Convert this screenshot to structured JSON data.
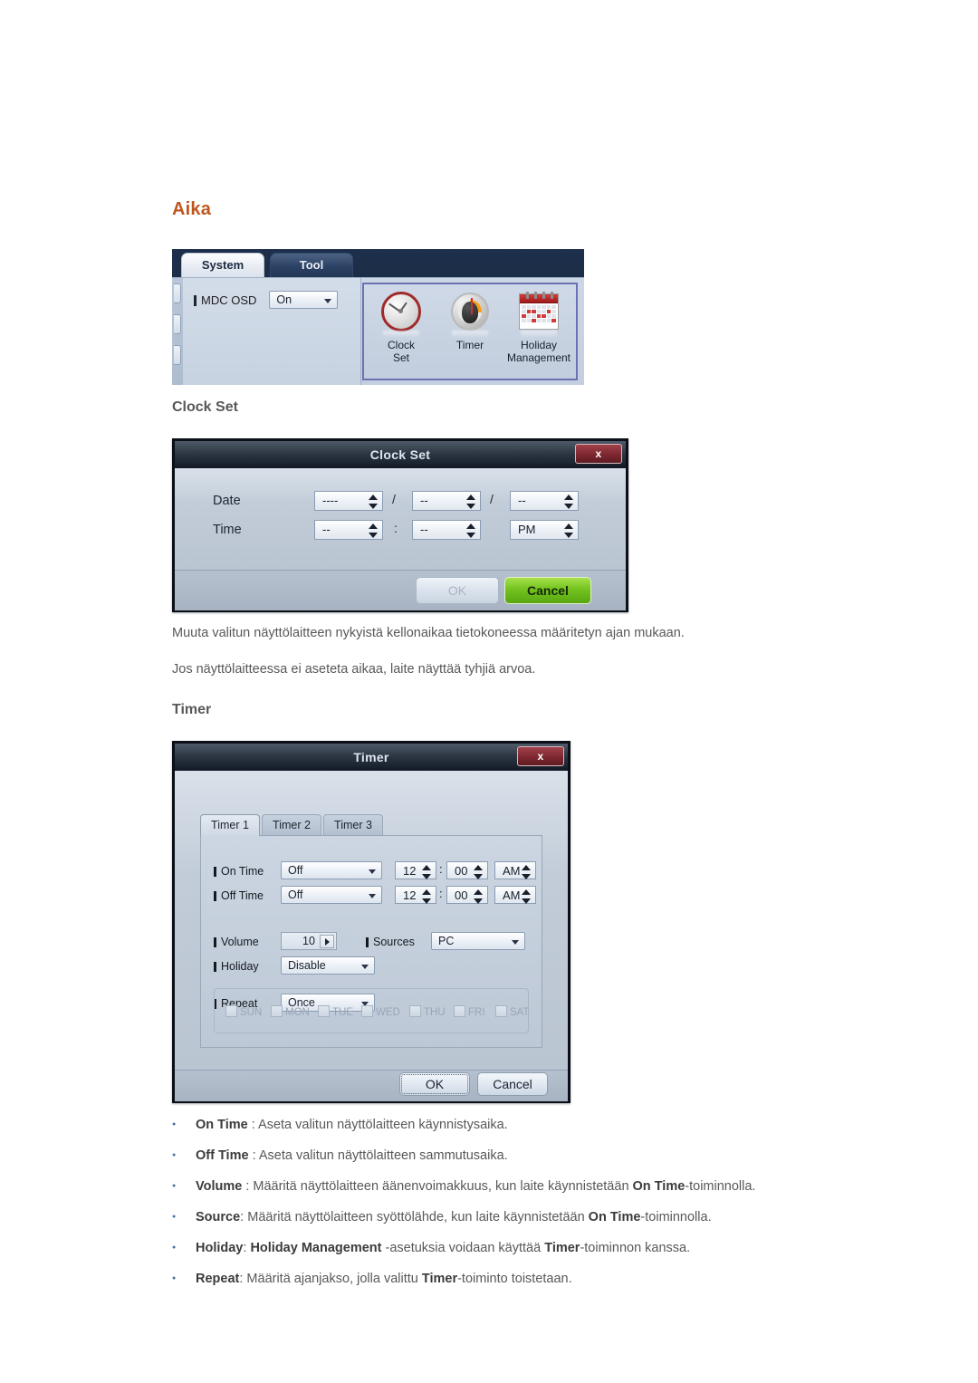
{
  "page": {
    "section_heading": "Aika",
    "accent_color": "#c0561f",
    "body_text_color": "#58585a",
    "bullet_color": "#4472a8"
  },
  "mdc_panel": {
    "tabs": [
      {
        "label": "System",
        "active": true
      },
      {
        "label": "Tool",
        "active": false
      }
    ],
    "settings": {
      "mdc_osd_label": "MDC OSD",
      "mdc_osd_value": "On"
    },
    "icon_group": {
      "highlight_color": "#6f6fb6",
      "items": [
        {
          "icon": "alarm-clock-icon",
          "line1": "Clock",
          "line2": "Set"
        },
        {
          "icon": "stopwatch-timer-icon",
          "line1": "Timer",
          "line2": ""
        },
        {
          "icon": "calendar-icon",
          "line1": "Holiday",
          "line2": "Management"
        }
      ]
    }
  },
  "clock_set": {
    "subheading": "Clock Set",
    "dialog": {
      "title": "Clock Set",
      "close_label": "x",
      "date_label": "Date",
      "time_label": "Time",
      "date_separator": "/",
      "time_separator": ":",
      "date_year": "----",
      "date_month": "--",
      "date_day": "--",
      "time_hour": "--",
      "time_minute": "--",
      "time_meridiem": "PM",
      "ok_label": "OK",
      "ok_enabled": false,
      "cancel_label": "Cancel"
    }
  },
  "paragraphs": [
    "Muuta valitun näyttölaitteen nykyistä kellonaikaa tietokoneessa määritetyn ajan mukaan.",
    "Jos näyttölaitteessa ei aseteta aikaa, laite näyttää tyhjiä arvoa."
  ],
  "timer": {
    "subheading": "Timer",
    "dialog": {
      "title": "Timer",
      "close_label": "x",
      "tabs": [
        {
          "label": "Timer 1",
          "active": true
        },
        {
          "label": "Timer 2",
          "active": false
        },
        {
          "label": "Timer 3",
          "active": false
        }
      ],
      "rows": {
        "on_time_label": "On Time",
        "on_time_mode": "Off",
        "on_time_hour": "12",
        "on_time_minute": "00",
        "on_time_meridiem": "AM",
        "off_time_label": "Off Time",
        "off_time_mode": "Off",
        "off_time_hour": "12",
        "off_time_minute": "00",
        "off_time_meridiem": "AM",
        "volume_label": "Volume",
        "volume_value": "10",
        "sources_label": "Sources",
        "sources_value": "PC",
        "holiday_label": "Holiday",
        "holiday_value": "Disable",
        "repeat_label": "Repeat",
        "repeat_value": "Once",
        "time_separator": ":"
      },
      "days": [
        {
          "label": "SUN",
          "checked": false
        },
        {
          "label": "MON",
          "checked": false
        },
        {
          "label": "TUE",
          "checked": false
        },
        {
          "label": "WED",
          "checked": false
        },
        {
          "label": "THU",
          "checked": false
        },
        {
          "label": "FRI",
          "checked": false
        },
        {
          "label": "SAT",
          "checked": false
        }
      ],
      "ok_label": "OK",
      "cancel_label": "Cancel"
    }
  },
  "bullets": [
    {
      "term": "On Time",
      "sep": " : ",
      "rest_before": "Aseta valitun näyttölaitteen käynnistysaika.",
      "emph": "",
      "rest_after": ""
    },
    {
      "term": "Off Time",
      "sep": " : ",
      "rest_before": "Aseta valitun näyttölaitteen sammutusaika.",
      "emph": "",
      "rest_after": ""
    },
    {
      "term": "Volume",
      "sep": " : ",
      "rest_before": "Määritä näyttölaitteen äänenvoimakkuus, kun laite käynnistetään ",
      "emph": "On Time",
      "rest_after": "-toiminnolla."
    },
    {
      "term": "Source",
      "sep": ": ",
      "rest_before": "Määritä näyttölaitteen syöttölähde, kun laite käynnistetään ",
      "emph": "On Time",
      "rest_after": "-toiminnolla."
    },
    {
      "term": "Holiday",
      "sep": ": ",
      "rest_before": "",
      "emph": "Holiday Management",
      "rest_after": " -asetuksia voidaan käyttää ",
      "emph2": "Timer",
      "rest_after2": "-toiminnon kanssa."
    },
    {
      "term": "Repeat",
      "sep": ": ",
      "rest_before": "Määritä ajanjakso, jolla valittu ",
      "emph": "Timer",
      "rest_after": "-toiminto toistetaan."
    }
  ]
}
